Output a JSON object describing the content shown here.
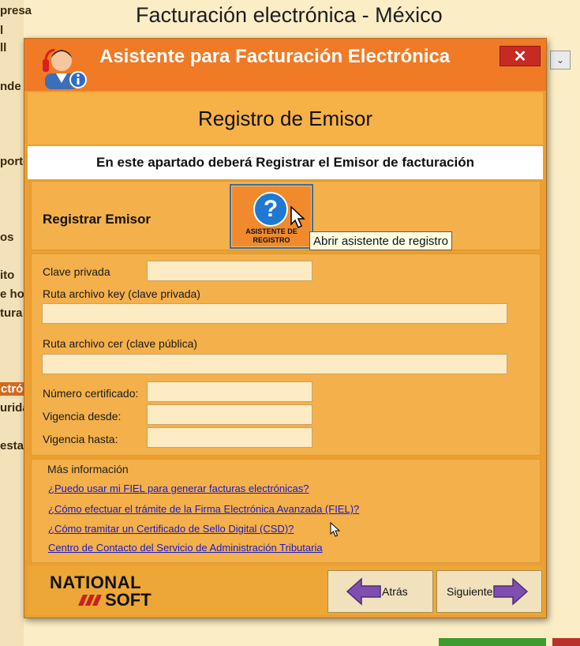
{
  "background": {
    "app_title": "Facturación electrónica - México",
    "sidebar_fragments": [
      "presa",
      "l",
      "ll",
      "nde",
      "porte",
      "os",
      "ito",
      "e ho",
      "tura",
      "ctró",
      "urida",
      "esta"
    ],
    "dropdown_glyph": "⌄"
  },
  "dialog": {
    "title": "Asistente para Facturación Electrónica",
    "close_glyph": "✕",
    "title_icon": "support-agent-icon",
    "header": "Registro de Emisor",
    "description": "En este apartado deberá Registrar el Emisor de facturación",
    "register": {
      "label": "Registrar Emisor",
      "button_line1": "ASISTENTE DE",
      "button_line2": "REGISTRO",
      "button_icon": "question-icon",
      "tooltip": "Abrir asistente de registro"
    },
    "form": {
      "clave_privada_label": "Clave privada",
      "clave_privada_value": "",
      "ruta_key_label": "Ruta archivo key (clave privada)",
      "ruta_key_value": "",
      "ruta_cer_label": "Ruta archivo cer (clave pública)",
      "ruta_cer_value": "",
      "numero_certificado_label": "Número certificado:",
      "numero_certificado_value": "",
      "vigencia_desde_label": "Vigencia desde:",
      "vigencia_desde_value": "",
      "vigencia_hasta_label": "Vigencia hasta:",
      "vigencia_hasta_value": ""
    },
    "info": {
      "title": "Más información",
      "links": [
        "¿Puedo usar mi FIEL para generar facturas electrónicas?",
        "¿Cómo efectuar el trámite de la Firma Electrónica Avanzada (FIEL)?",
        "¿Cómo tramitar un Certificado de Sello Digital (CSD)?",
        "Centro de Contacto del Servicio de Administración Tributaria"
      ]
    },
    "footer": {
      "logo_line1": "NATIONAL",
      "logo_line2": "SOFT",
      "back_label": "Atrás",
      "next_label": "Siguiente"
    }
  },
  "colors": {
    "titlebar": "#f07a25",
    "dialog_bg": "#ec9f2e",
    "panel": "#f3b04b",
    "close": "#c62a22",
    "link": "#1a1ac8",
    "arrow": "#7f4fb0"
  }
}
